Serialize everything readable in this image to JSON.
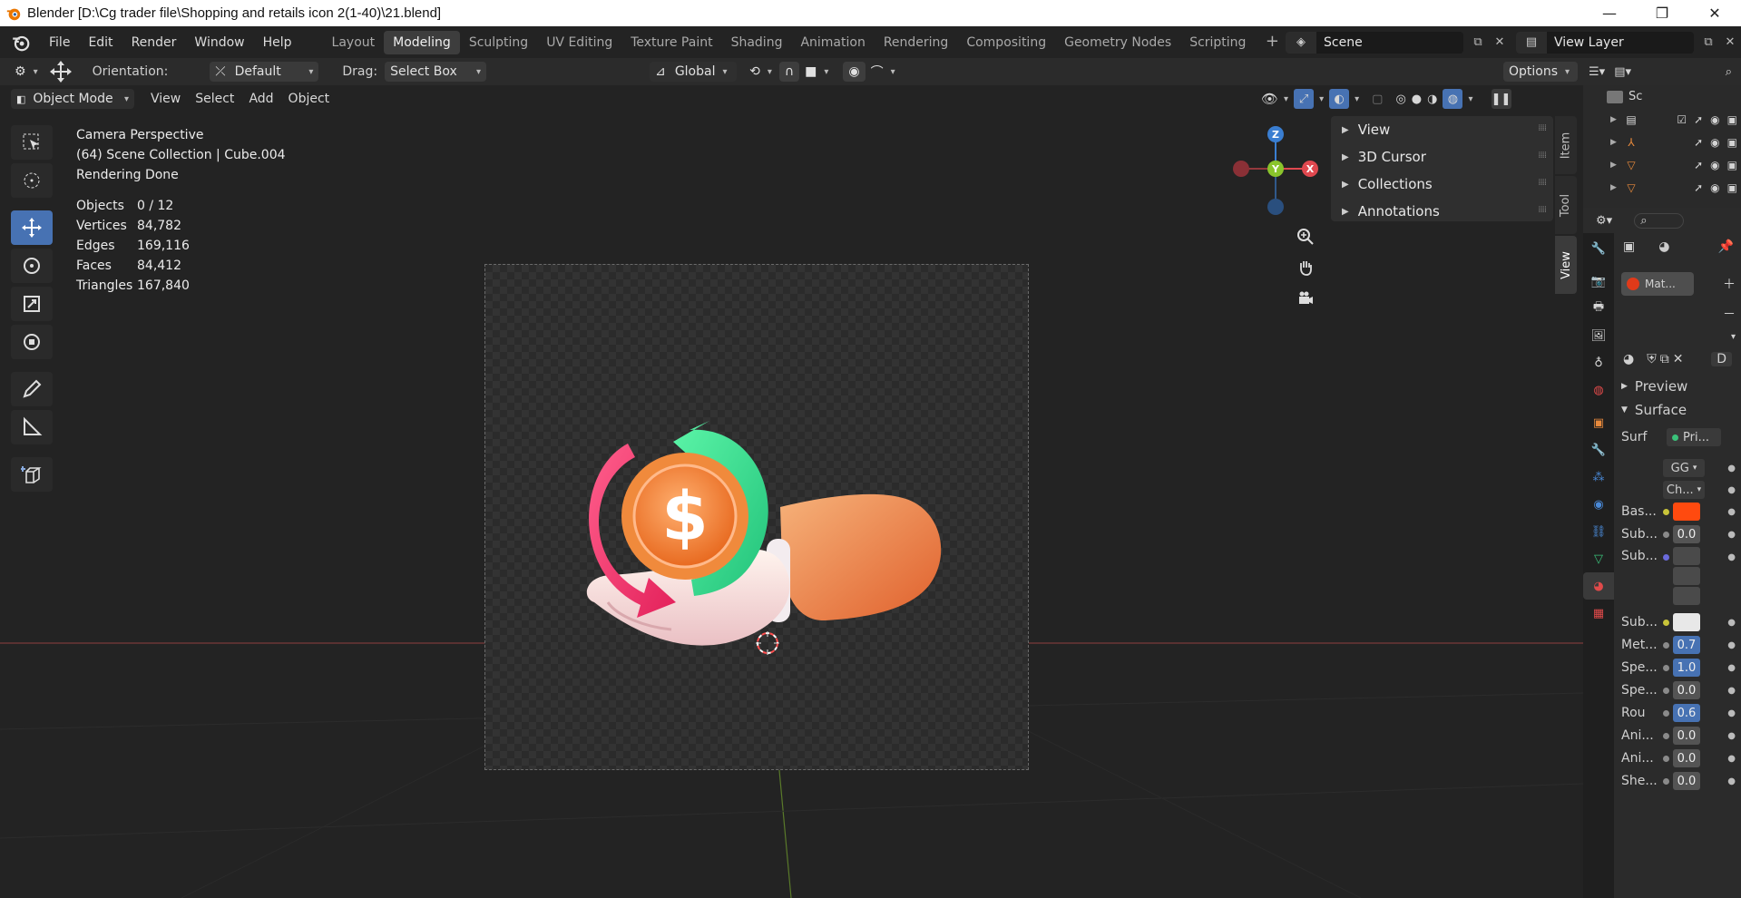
{
  "window": {
    "title": "Blender [D:\\Cg trader file\\Shopping and retails icon 2(1-40)\\21.blend]",
    "controls": [
      "—",
      "❐",
      "✕"
    ]
  },
  "menubar": {
    "items": [
      "File",
      "Edit",
      "Render",
      "Window",
      "Help"
    ],
    "workspaces": [
      "Layout",
      "Modeling",
      "Sculpting",
      "UV Editing",
      "Texture Paint",
      "Shading",
      "Animation",
      "Rendering",
      "Compositing",
      "Geometry Nodes",
      "Scripting"
    ],
    "active_workspace": "Modeling",
    "add_tab": "+",
    "scene": "Scene",
    "view_layer": "View Layer"
  },
  "toolheader": {
    "orientation_label": "Orientation:",
    "orientation_value": "Default",
    "drag_label": "Drag:",
    "drag_value": "Select Box",
    "transform_space": "Global",
    "options": "Options"
  },
  "vpheader": {
    "mode": "Object Mode",
    "menus": [
      "View",
      "Select",
      "Add",
      "Object"
    ]
  },
  "overlay": {
    "line1": "Camera Perspective",
    "line2": "(64) Scene Collection | Cube.004",
    "line3": "Rendering Done",
    "stats": [
      {
        "k": "Objects",
        "v": "0 / 12"
      },
      {
        "k": "Vertices",
        "v": "84,782"
      },
      {
        "k": "Edges",
        "v": "169,116"
      },
      {
        "k": "Faces",
        "v": "84,412"
      },
      {
        "k": "Triangles",
        "v": "167,840"
      }
    ]
  },
  "npanel": {
    "sections": [
      "View",
      "3D Cursor",
      "Collections",
      "Annotations"
    ],
    "tabs": [
      "Item",
      "Tool",
      "View"
    ]
  },
  "gizmo": {
    "x": "X",
    "y": "Y",
    "z": "Z"
  },
  "outliner": {
    "header": "Sc"
  },
  "properties": {
    "material_slot": "Mat...",
    "browse_value": "D",
    "sections": [
      "Preview",
      "Surface"
    ],
    "surface_label": "Surf",
    "surface_value": "Pri...",
    "gg": "GG",
    "ch": "Ch...",
    "rows": [
      {
        "label": "Bas...",
        "value": "",
        "color": "#ff4a0f"
      },
      {
        "label": "Sub...",
        "value": "0.0"
      },
      {
        "label": "Sub...",
        "value": ""
      },
      {
        "label": "Sub...",
        "value": "",
        "color": "#e8e8e8"
      },
      {
        "label": "Met...",
        "value": "0.7",
        "highlight": true
      },
      {
        "label": "Spe...",
        "value": "1.0",
        "highlight": true
      },
      {
        "label": "Spe...",
        "value": "0.0"
      },
      {
        "label": "Rou",
        "value": "0.6",
        "highlight": true
      },
      {
        "label": "Ani...",
        "value": "0.0"
      },
      {
        "label": "Ani...",
        "value": "0.0"
      },
      {
        "label": "She...",
        "value": "0.0"
      }
    ]
  },
  "colors": {
    "accent": "#4772b3",
    "x_axis": "#e0484f",
    "y_axis": "#8ac42c",
    "z_axis": "#3a7ed1",
    "base_color": "#ff4a0f"
  }
}
